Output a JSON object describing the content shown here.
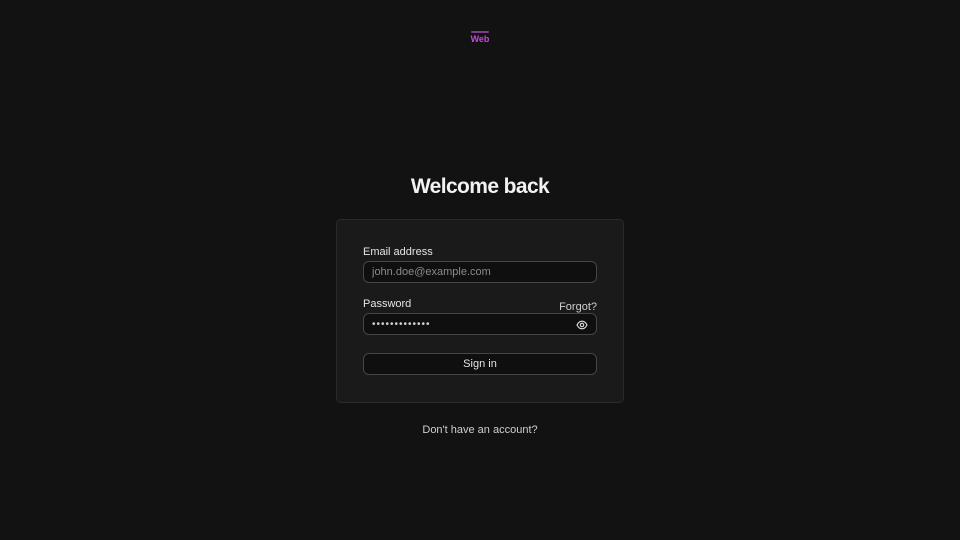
{
  "logo": {
    "top_text": "",
    "main_text": "Web",
    "color": "#c04bd6"
  },
  "heading": "Welcome back",
  "form": {
    "email_label": "Email address",
    "email_placeholder": "john.doe@example.com",
    "email_value": "",
    "password_label": "Password",
    "password_value": "•••••••••••••",
    "forgot_label": "Forgot?",
    "password_toggle_icon": "eye-icon",
    "submit_label": "Sign in"
  },
  "signup_prompt": "Don't have an account?",
  "colors": {
    "background": "#121212",
    "card": "#1a1a1a",
    "card_border": "#2a2a2a",
    "input_border": "#454545",
    "accent": "#c04bd6"
  }
}
